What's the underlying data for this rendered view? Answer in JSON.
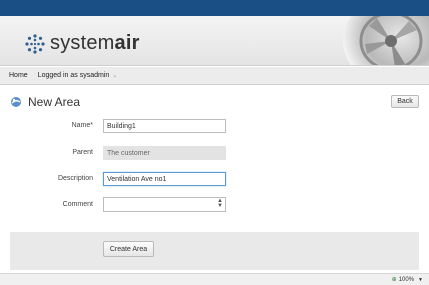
{
  "header": {
    "logo_text_light": "system",
    "logo_text_bold": "air"
  },
  "nav": {
    "home_label": "Home",
    "user_label": "Logged in as sysadmin"
  },
  "page": {
    "title": "New Area",
    "back_label": "Back"
  },
  "form": {
    "name_label": "Name*",
    "name_value": "Building1",
    "parent_label": "Parent",
    "parent_value": "The customer",
    "description_label": "Description",
    "description_value": "Ventilation Ave no1",
    "comment_label": "Comment",
    "comment_value": ""
  },
  "actions": {
    "create_label": "Create Area"
  },
  "status": {
    "zoom": "100%"
  },
  "colors": {
    "top_bar": "#1a4f86",
    "focus_border": "#5b9bd5"
  }
}
